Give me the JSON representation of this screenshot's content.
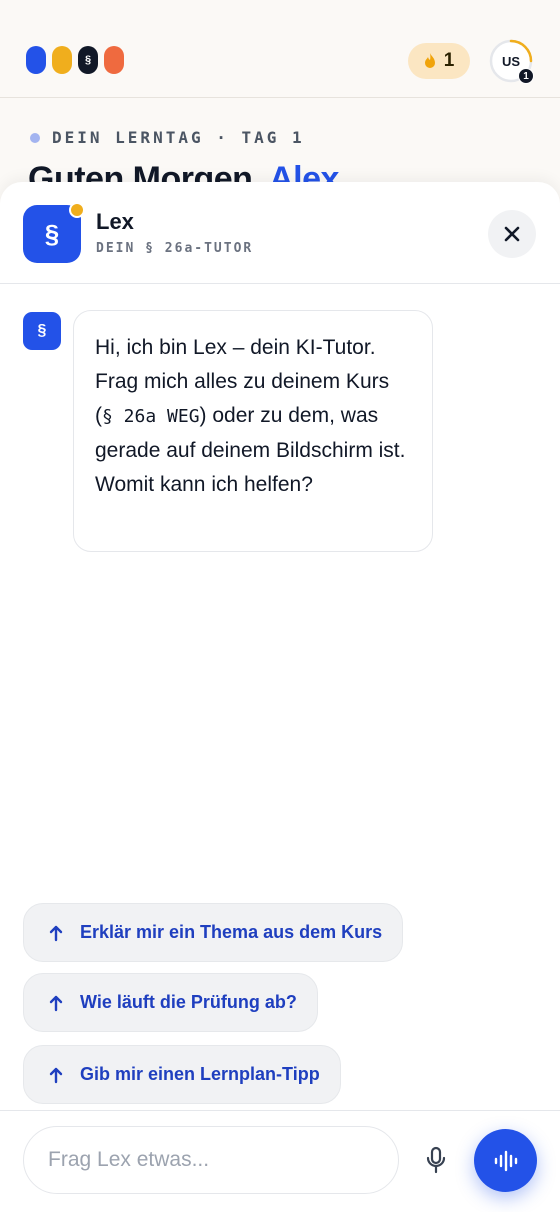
{
  "header": {
    "logo_glyph": "§",
    "streak_count": "1",
    "user_initials": "US",
    "user_level": "1",
    "streak_progress": 0.25
  },
  "today": {
    "label": "DEIN LERNTAG · TAG 1",
    "greeting_prefix": "Guten Morgen,",
    "greeting_name": "Alex"
  },
  "tutor": {
    "badge_glyph": "§",
    "name": "Lex",
    "subtitle": "DEIN § 26a-TUTOR"
  },
  "messages": [
    {
      "from": "Lex",
      "avatar_glyph": "§",
      "text_before": "Hi, ich bin Lex – dein KI-Tutor. Frag mich alles zu deinem Kurs (",
      "code": "§ 26a WEG",
      "text_after": ") oder zu dem, was gerade auf deinem Bildschirm ist. Womit kann ich helfen?"
    }
  ],
  "suggestions": [
    "Erklär mir ein Thema aus dem Kurs",
    "Wie läuft die Prüfung ab?",
    "Gib mir einen Lernplan-Tipp"
  ],
  "composer": {
    "placeholder": "Frag Lex etwas..."
  },
  "colors": {
    "accent": "#2352e8",
    "streak_bg": "#fbe6c2",
    "online_dot": "#f0ae1d",
    "suggestion_text": "#1f3fbf"
  },
  "icons": {
    "logo": "brand-logo-four-pills",
    "streak": "flame-icon",
    "close": "close-icon",
    "suggestion": "arrow-up-icon",
    "mic": "microphone-icon",
    "voice": "audio-waveform-icon"
  }
}
